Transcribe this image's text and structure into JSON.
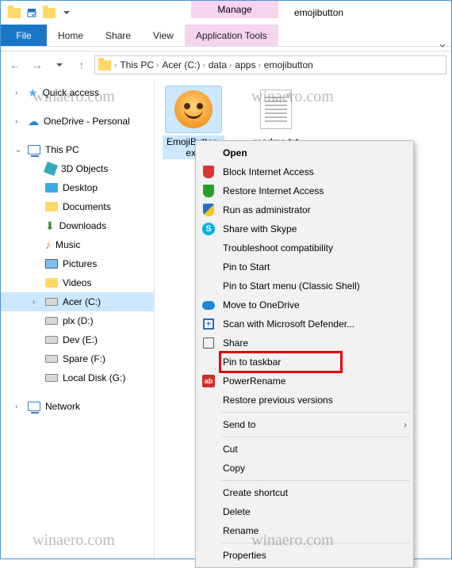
{
  "title": "emojibutton",
  "contextual_tab_label": "Manage",
  "ribbon": {
    "file": "File",
    "tabs": [
      "Home",
      "Share",
      "View"
    ],
    "context_tab": "Application Tools"
  },
  "breadcrumbs": [
    "This PC",
    "Acer (C:)",
    "data",
    "apps",
    "emojibutton"
  ],
  "sidebar": {
    "quick_access": "Quick access",
    "onedrive": "OneDrive - Personal",
    "this_pc": "This PC",
    "items": [
      {
        "label": "3D Objects",
        "icon": "cube"
      },
      {
        "label": "Desktop",
        "icon": "desktop"
      },
      {
        "label": "Documents",
        "icon": "folder"
      },
      {
        "label": "Downloads",
        "icon": "down"
      },
      {
        "label": "Music",
        "icon": "music"
      },
      {
        "label": "Pictures",
        "icon": "pic"
      },
      {
        "label": "Videos",
        "icon": "folder"
      },
      {
        "label": "Acer (C:)",
        "icon": "drive",
        "selected": true
      },
      {
        "label": "plx (D:)",
        "icon": "drive"
      },
      {
        "label": "Dev (E:)",
        "icon": "drive"
      },
      {
        "label": "Spare (F:)",
        "icon": "drive"
      },
      {
        "label": "Local Disk (G:)",
        "icon": "drive"
      }
    ],
    "network": "Network"
  },
  "files": [
    {
      "label": "EmojiButton.exe",
      "type": "emoji",
      "selected": true
    },
    {
      "label": "readme.txt",
      "type": "doc",
      "selected": false
    }
  ],
  "context_menu": {
    "groups": [
      [
        {
          "label": "Open",
          "bold": true,
          "icon": ""
        },
        {
          "label": "Block Internet Access",
          "icon": "shield-red"
        },
        {
          "label": "Restore Internet Access",
          "icon": "shield-green"
        },
        {
          "label": "Run as administrator",
          "icon": "shield-blueyellow"
        },
        {
          "label": "Share with Skype",
          "icon": "skype"
        },
        {
          "label": "Troubleshoot compatibility",
          "icon": ""
        },
        {
          "label": "Pin to Start",
          "icon": ""
        },
        {
          "label": "Pin to Start menu (Classic Shell)",
          "icon": ""
        },
        {
          "label": "Move to OneDrive",
          "icon": "cloud"
        },
        {
          "label": "Scan with Microsoft Defender...",
          "icon": "defender"
        },
        {
          "label": "Share",
          "icon": "share"
        },
        {
          "label": "Pin to taskbar",
          "icon": "",
          "highlighted": true
        },
        {
          "label": "PowerRename",
          "icon": "pr"
        },
        {
          "label": "Restore previous versions",
          "icon": ""
        }
      ],
      [
        {
          "label": "Send to",
          "icon": "",
          "submenu": true
        }
      ],
      [
        {
          "label": "Cut",
          "icon": ""
        },
        {
          "label": "Copy",
          "icon": ""
        }
      ],
      [
        {
          "label": "Create shortcut",
          "icon": ""
        },
        {
          "label": "Delete",
          "icon": ""
        },
        {
          "label": "Rename",
          "icon": ""
        }
      ],
      [
        {
          "label": "Properties",
          "icon": ""
        }
      ]
    ]
  },
  "watermark": "winaero.com"
}
